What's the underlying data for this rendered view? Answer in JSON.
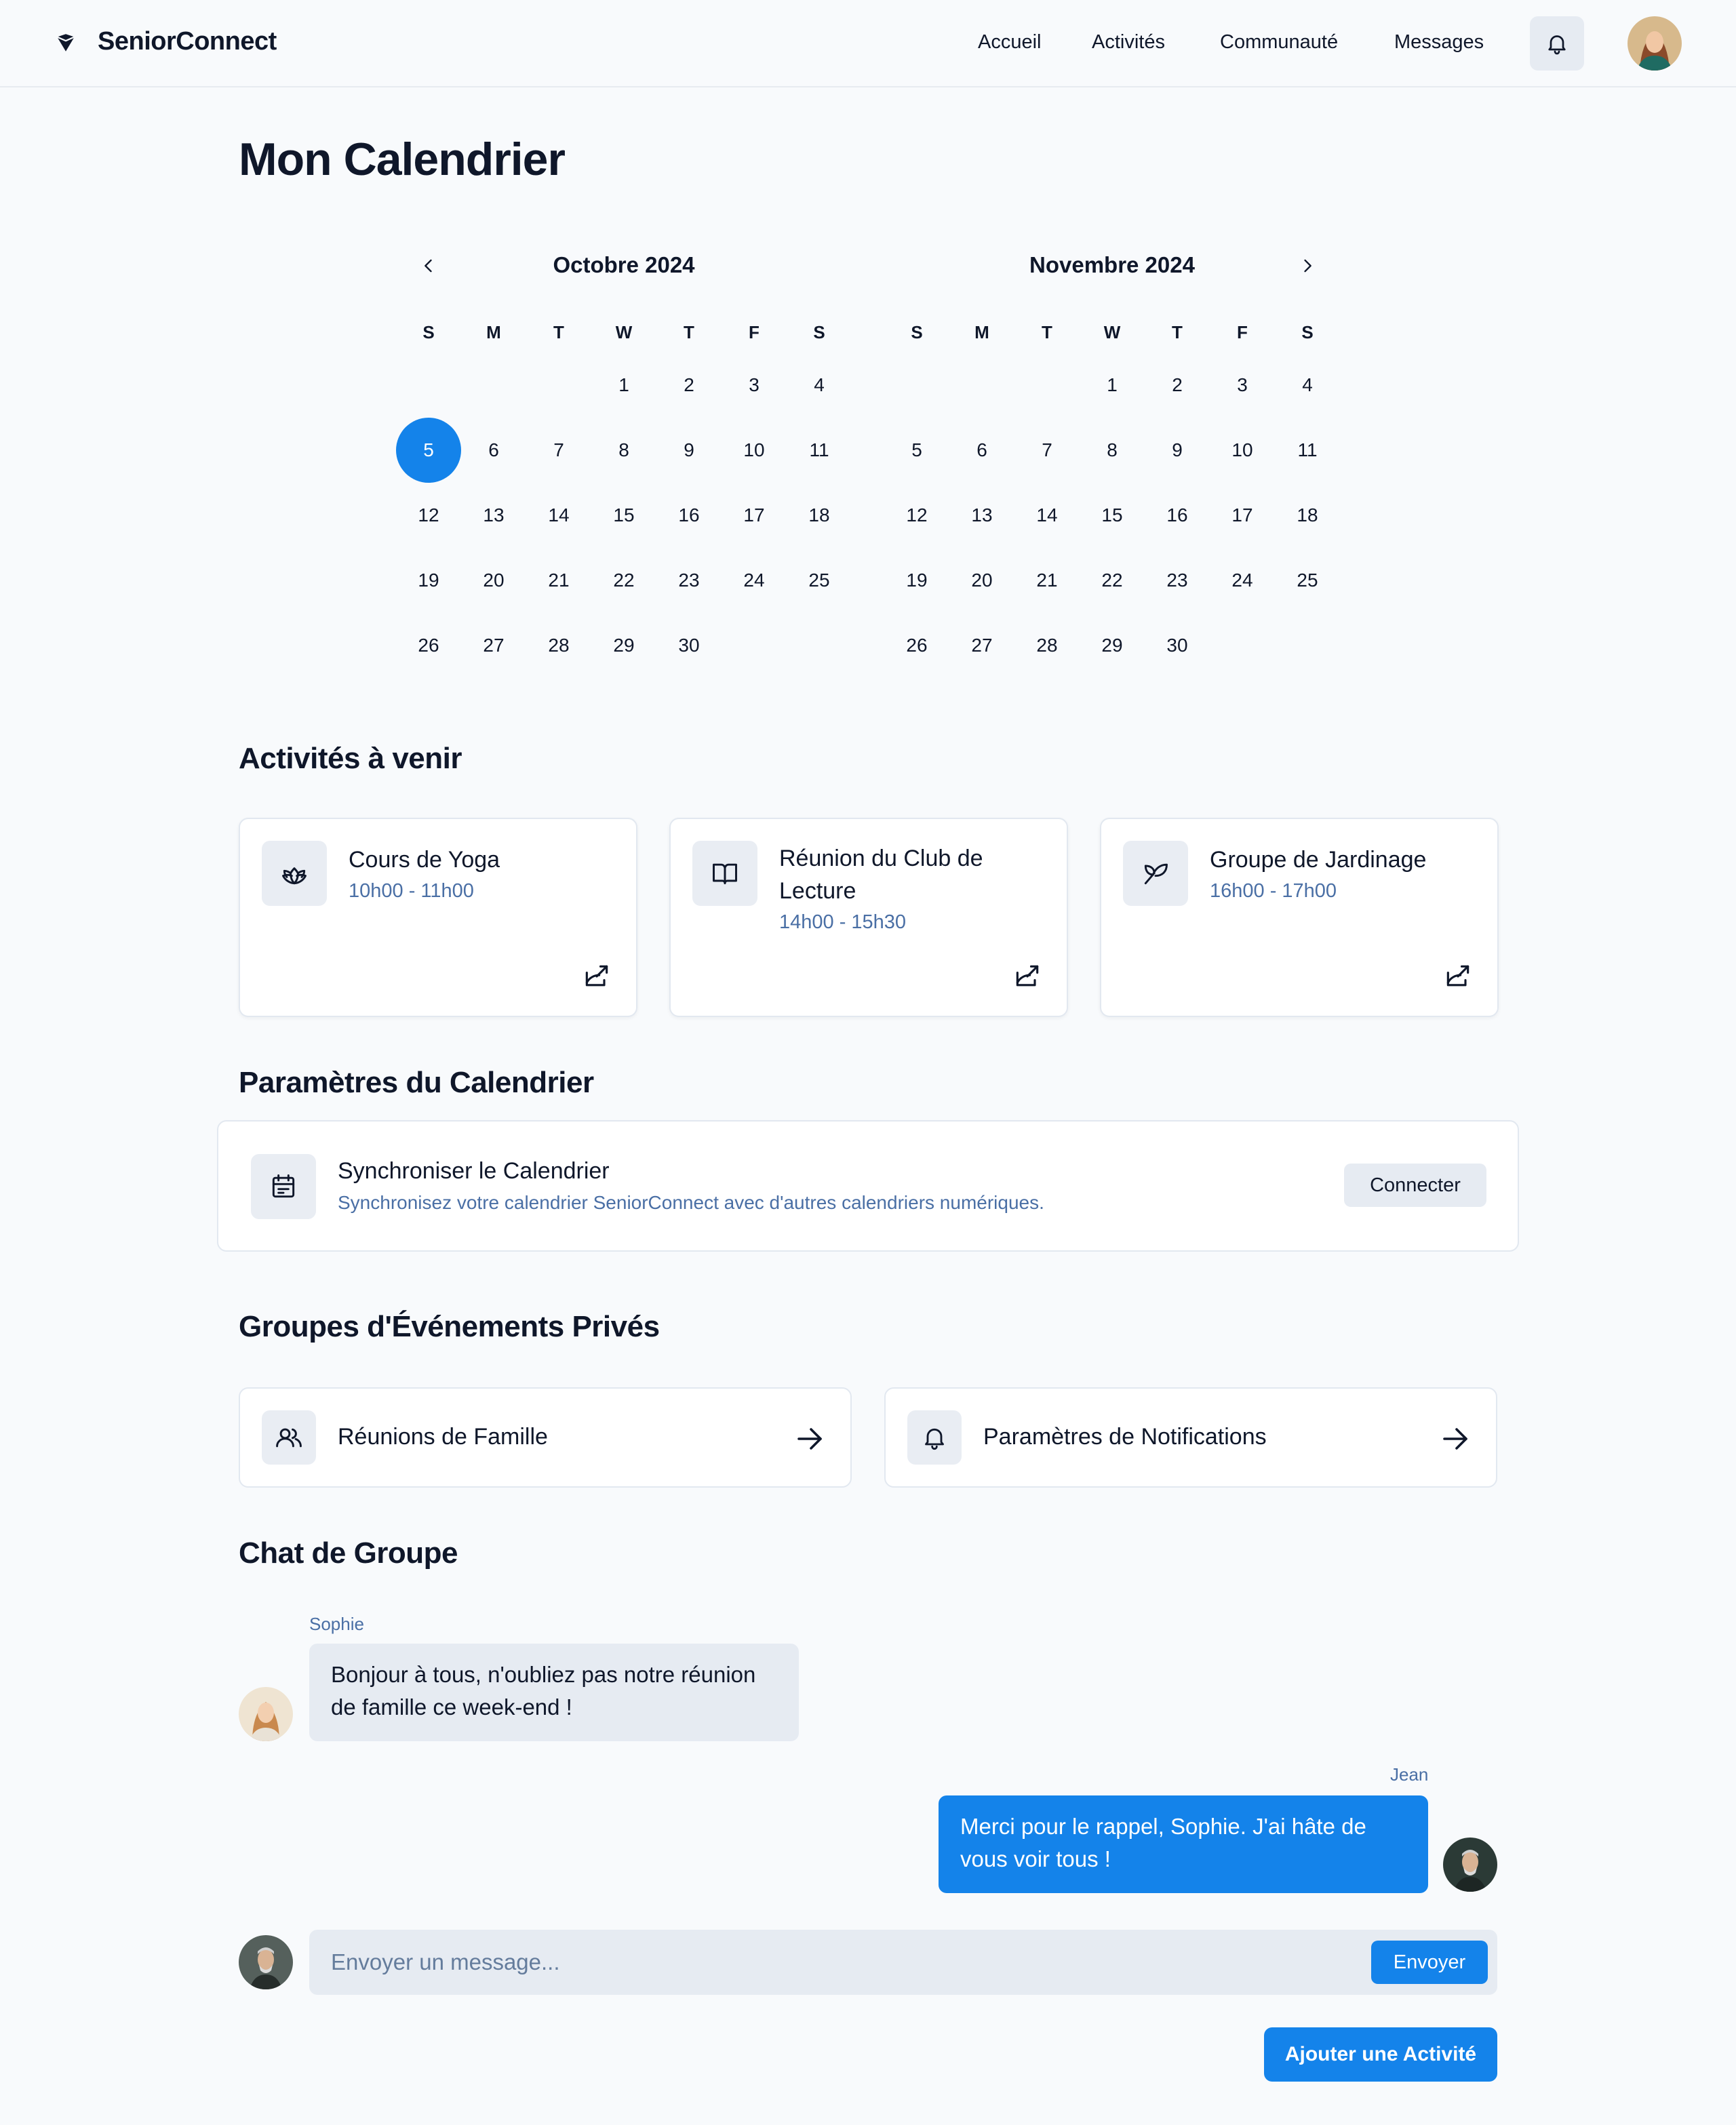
{
  "header": {
    "brand": "SeniorConnect",
    "nav": [
      "Accueil",
      "Activités",
      "Communauté",
      "Messages"
    ]
  },
  "page_title": "Mon Calendrier",
  "calendar": {
    "weekdays": [
      "S",
      "M",
      "T",
      "W",
      "T",
      "F",
      "S"
    ],
    "months": [
      {
        "title": "Octobre 2024",
        "weeks": [
          [
            "",
            "",
            "",
            "1",
            "2",
            "3",
            "4"
          ],
          [
            "5",
            "6",
            "7",
            "8",
            "9",
            "10",
            "11"
          ],
          [
            "12",
            "13",
            "14",
            "15",
            "16",
            "17",
            "18"
          ],
          [
            "19",
            "20",
            "21",
            "22",
            "23",
            "24",
            "25"
          ],
          [
            "26",
            "27",
            "28",
            "29",
            "30",
            "",
            ""
          ]
        ],
        "selected_day": "5"
      },
      {
        "title": "Novembre 2024",
        "weeks": [
          [
            "",
            "",
            "",
            "1",
            "2",
            "3",
            "4"
          ],
          [
            "5",
            "6",
            "7",
            "8",
            "9",
            "10",
            "11"
          ],
          [
            "12",
            "13",
            "14",
            "15",
            "16",
            "17",
            "18"
          ],
          [
            "19",
            "20",
            "21",
            "22",
            "23",
            "24",
            "25"
          ],
          [
            "26",
            "27",
            "28",
            "29",
            "30",
            "",
            ""
          ]
        ]
      }
    ]
  },
  "activities": {
    "title": "Activités à venir",
    "items": [
      {
        "title": "Cours de Yoga",
        "time": "10h00 - 11h00",
        "icon": "lotus-icon"
      },
      {
        "title": "Réunion du Club de Lecture",
        "time": "14h00 - 15h30",
        "icon": "book-icon"
      },
      {
        "title": "Groupe de Jardinage",
        "time": "16h00 - 17h00",
        "icon": "sprout-icon"
      }
    ]
  },
  "settings": {
    "title": "Paramètres du Calendrier",
    "sync_title": "Synchroniser le Calendrier",
    "sync_desc": "Synchronisez votre calendrier SeniorConnect avec d'autres calendriers numériques.",
    "connect_label": "Connecter"
  },
  "groups": {
    "title": "Groupes d'Événements Privés",
    "items": [
      {
        "label": "Réunions de Famille",
        "icon": "users-icon"
      },
      {
        "label": "Paramètres de Notifications",
        "icon": "bell-icon"
      }
    ]
  },
  "chat": {
    "title": "Chat de Groupe",
    "messages": [
      {
        "author": "Sophie",
        "text": "Bonjour à tous, n'oubliez pas notre réunion de famille ce week-end !"
      },
      {
        "author": "Jean",
        "text": "Merci pour le rappel, Sophie. J'ai hâte de vous voir tous !"
      }
    ],
    "input_placeholder": "Envoyer un message...",
    "send_label": "Envoyer"
  },
  "add_activity_label": "Ajouter une Activité",
  "colors": {
    "accent": "#1483ea",
    "muted_text": "#4a6fa5",
    "chip_bg": "#e6ebf2"
  }
}
